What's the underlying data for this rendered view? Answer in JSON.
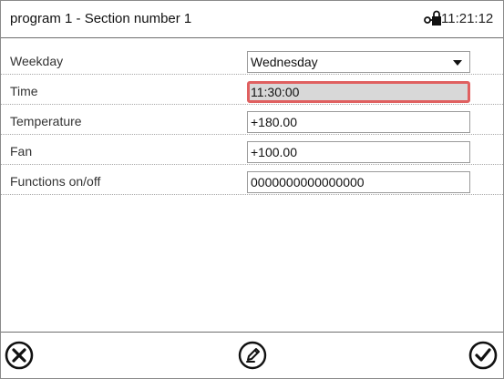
{
  "header": {
    "title": "program 1 - Section number 1",
    "time": "11:21:12",
    "lock_icon": "key-lock-icon"
  },
  "rows": [
    {
      "label": "Weekday",
      "value": "Wednesday",
      "control": "dropdown"
    },
    {
      "label": "Time",
      "value": "11:30:00",
      "control": "text-input",
      "selected": true
    },
    {
      "label": "Temperature",
      "value": "+180.00",
      "control": "text-input"
    },
    {
      "label": "Fan",
      "value": "+100.00",
      "control": "text-input"
    },
    {
      "label": "Functions on/off",
      "value": "0000000000000000",
      "control": "text-input"
    }
  ],
  "footer": {
    "buttons": [
      {
        "icon": "close-circle-icon"
      },
      {
        "icon": "pencil-edit-icon"
      },
      {
        "icon": "checkmark-circle-icon"
      }
    ]
  },
  "colors": {
    "selection_border": "#e06060",
    "selection_fill": "#d8d8d8"
  }
}
